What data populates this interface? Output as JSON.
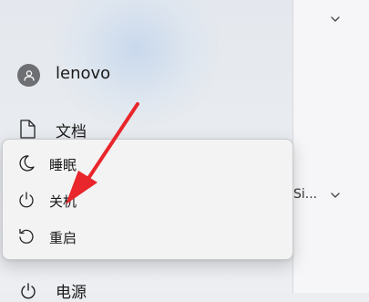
{
  "user": {
    "name": "lenovo",
    "icon": "user-icon"
  },
  "pinned": [
    {
      "label": "文档",
      "icon": "document-icon"
    },
    {
      "label": "电源",
      "icon": "power-icon"
    }
  ],
  "power_menu": {
    "items": [
      {
        "label": "睡眠",
        "icon": "moon-icon"
      },
      {
        "label": "关机",
        "icon": "power-icon"
      },
      {
        "label": "重启",
        "icon": "restart-icon"
      }
    ]
  },
  "right_pane": {
    "partial_text": "Si..."
  },
  "colors": {
    "annotation_arrow": "#e8262b"
  }
}
